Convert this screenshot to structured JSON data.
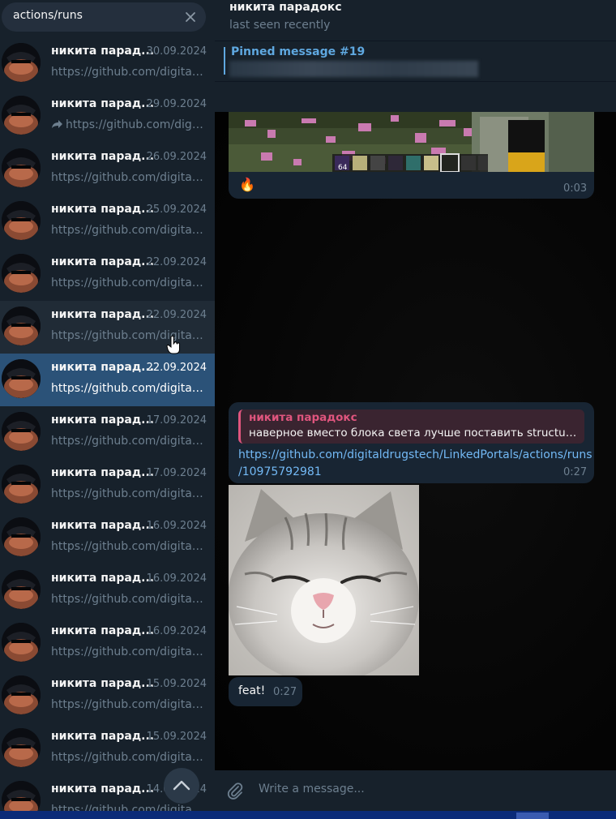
{
  "search": {
    "query": "actions/runs"
  },
  "results": [
    {
      "name": "никита парад...",
      "date": "30.09.2024",
      "text": "https://github.com/digital...",
      "forwarded": false,
      "state": "normal"
    },
    {
      "name": "никита парад...",
      "date": "29.09.2024",
      "text": "https://github.com/digit...",
      "forwarded": true,
      "state": "normal"
    },
    {
      "name": "никита парад...",
      "date": "26.09.2024",
      "text": "https://github.com/digital...",
      "forwarded": false,
      "state": "normal"
    },
    {
      "name": "никита парад...",
      "date": "25.09.2024",
      "text": "https://github.com/digital...",
      "forwarded": false,
      "state": "normal"
    },
    {
      "name": "никита парад...",
      "date": "22.09.2024",
      "text": "https://github.com/digital...",
      "forwarded": false,
      "state": "normal"
    },
    {
      "name": "никита парад...",
      "date": "22.09.2024",
      "text": "https://github.com/digital...",
      "forwarded": false,
      "state": "hover"
    },
    {
      "name": "никита парад...",
      "date": "22.09.2024",
      "text": "https://github.com/digital...",
      "forwarded": false,
      "state": "active"
    },
    {
      "name": "никита парад...",
      "date": "17.09.2024",
      "text": "https://github.com/digital...",
      "forwarded": false,
      "state": "normal"
    },
    {
      "name": "никита парад...",
      "date": "17.09.2024",
      "text": "https://github.com/digital...",
      "forwarded": false,
      "state": "normal"
    },
    {
      "name": "никита парад...",
      "date": "16.09.2024",
      "text": "https://github.com/digital...",
      "forwarded": false,
      "state": "normal"
    },
    {
      "name": "никита парад...",
      "date": "16.09.2024",
      "text": "https://github.com/digital...",
      "forwarded": false,
      "state": "normal"
    },
    {
      "name": "никита парад...",
      "date": "16.09.2024",
      "text": "https://github.com/digital...",
      "forwarded": false,
      "state": "normal"
    },
    {
      "name": "никита парад...",
      "date": "15.09.2024",
      "text": "https://github.com/digital...",
      "forwarded": false,
      "state": "normal"
    },
    {
      "name": "никита парад...",
      "date": "15.09.2024",
      "text": "https://github.com/digital...",
      "forwarded": false,
      "state": "normal"
    },
    {
      "name": "никита парад...",
      "date": "14.09.2024",
      "text": "https://github.com/digital...",
      "forwarded": false,
      "state": "normal"
    }
  ],
  "chat": {
    "name": "никита парадокс",
    "status": "last seen recently",
    "pinned_title": "Pinned message #19"
  },
  "messages": {
    "image_message": {
      "emoji": "🔥",
      "time": "0:03",
      "hotbar_count": "64"
    },
    "link_message": {
      "reply_name": "никита парадокс",
      "reply_text": "наверное вместо блока света лучше поставить structure void",
      "link_line1": "https://github.com/digitaldrugstech/LinkedPortals/actions/runs",
      "link_line2": "/10975792981",
      "time": "0:27"
    },
    "text_message": {
      "text": "feat!",
      "time": "0:27"
    }
  },
  "composer": {
    "placeholder": "Write a message..."
  },
  "colors": {
    "sidebar_bg": "#17212b",
    "active_row": "#2b5278",
    "link": "#73b9f5",
    "accent": "#5fa8e0",
    "reply_accent": "#e0557e"
  }
}
